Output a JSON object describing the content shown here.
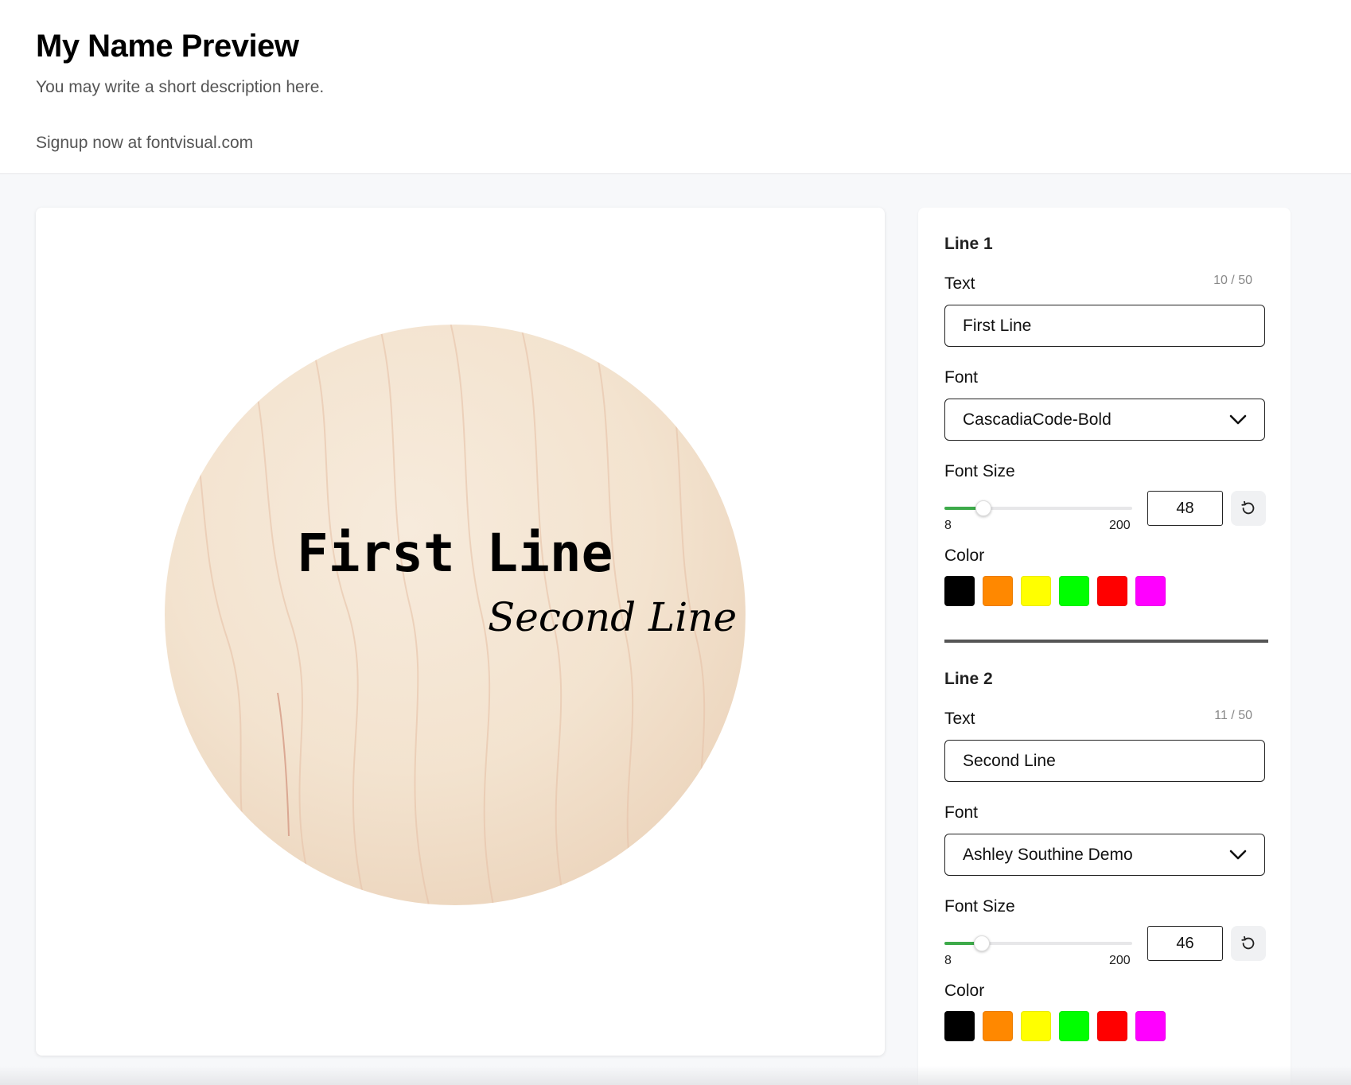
{
  "header": {
    "title": "My Name Preview",
    "description": "You may write a short description here.",
    "signup": "Signup now at fontvisual.com"
  },
  "preview": {
    "line1_text": "First Line",
    "line2_text": "Second Line"
  },
  "panel": {
    "lines": [
      {
        "title": "Line 1",
        "text_label": "Text",
        "char_count": "10 / 50",
        "text_value": "First Line",
        "font_label": "Font",
        "font_value": "CascadiaCode-Bold",
        "size_label": "Font Size",
        "size_min": "8",
        "size_max": "200",
        "size_value": "48",
        "color_label": "Color"
      },
      {
        "title": "Line 2",
        "text_label": "Text",
        "char_count": "11 / 50",
        "text_value": "Second Line",
        "font_label": "Font",
        "font_value": "Ashley Southine Demo",
        "size_label": "Font Size",
        "size_min": "8",
        "size_max": "200",
        "size_value": "46",
        "color_label": "Color"
      }
    ],
    "swatch_colors": [
      "#000000",
      "#ff8800",
      "#ffff00",
      "#00ff00",
      "#ff0000",
      "#ff00ff"
    ]
  },
  "icons": {
    "chevron": "chevron-down-icon",
    "reset": "reset-icon"
  }
}
